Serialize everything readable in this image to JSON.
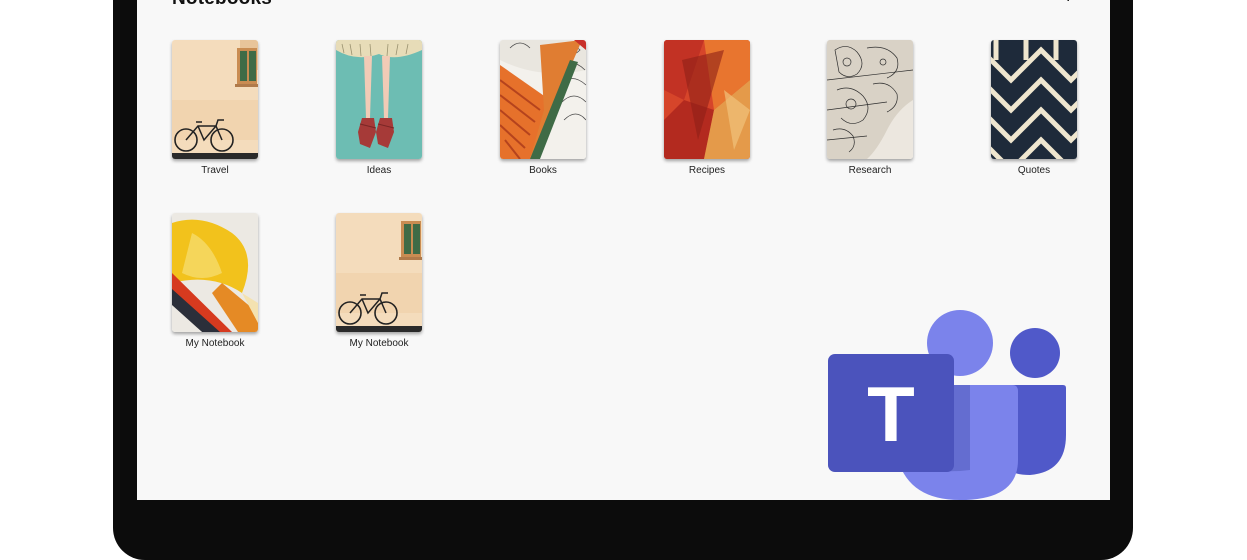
{
  "header": {
    "title": "Notebooks",
    "add_label": "+"
  },
  "notebooks": [
    {
      "name": "Travel",
      "cover": "bicycle-wall"
    },
    {
      "name": "Ideas",
      "cover": "ballet-dancer"
    },
    {
      "name": "Books",
      "cover": "orange-pattern"
    },
    {
      "name": "Recipes",
      "cover": "red-abstract"
    },
    {
      "name": "Research",
      "cover": "zentangle-elephant"
    },
    {
      "name": "Quotes",
      "cover": "navy-weave"
    },
    {
      "name": "My Notebook",
      "cover": "yellow-brush"
    },
    {
      "name": "My Notebook",
      "cover": "bicycle-wall"
    }
  ],
  "overlay": {
    "logo": "microsoft-teams-logo",
    "letter": "T"
  },
  "colors": {
    "screen_bg": "#f8f8f8",
    "bezel": "#0c0c0c",
    "teams_purple": "#5059c9",
    "teams_light": "#7b83eb"
  }
}
